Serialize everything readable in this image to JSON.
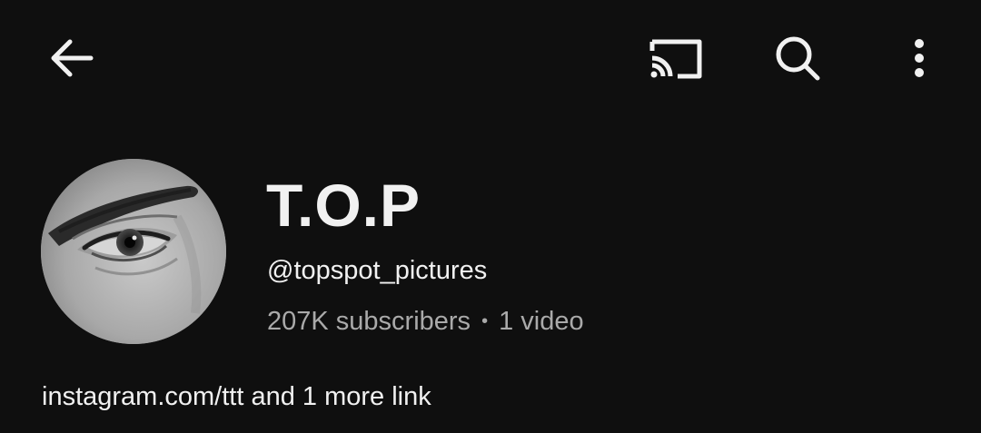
{
  "header": {
    "icons": {
      "back": "back-arrow-icon",
      "cast": "cast-icon",
      "search": "search-icon",
      "more": "more-vert-icon"
    }
  },
  "channel": {
    "name": "T.O.P",
    "handle": "@topspot_pictures",
    "subscribers": "207K subscribers",
    "separator": "•",
    "videos": "1 video",
    "links_text": "instagram.com/ttt and 1 more link"
  },
  "colors": {
    "background": "#0f0f0f",
    "primary_text": "#f1f1f1",
    "secondary_text": "#aaaaaa"
  }
}
